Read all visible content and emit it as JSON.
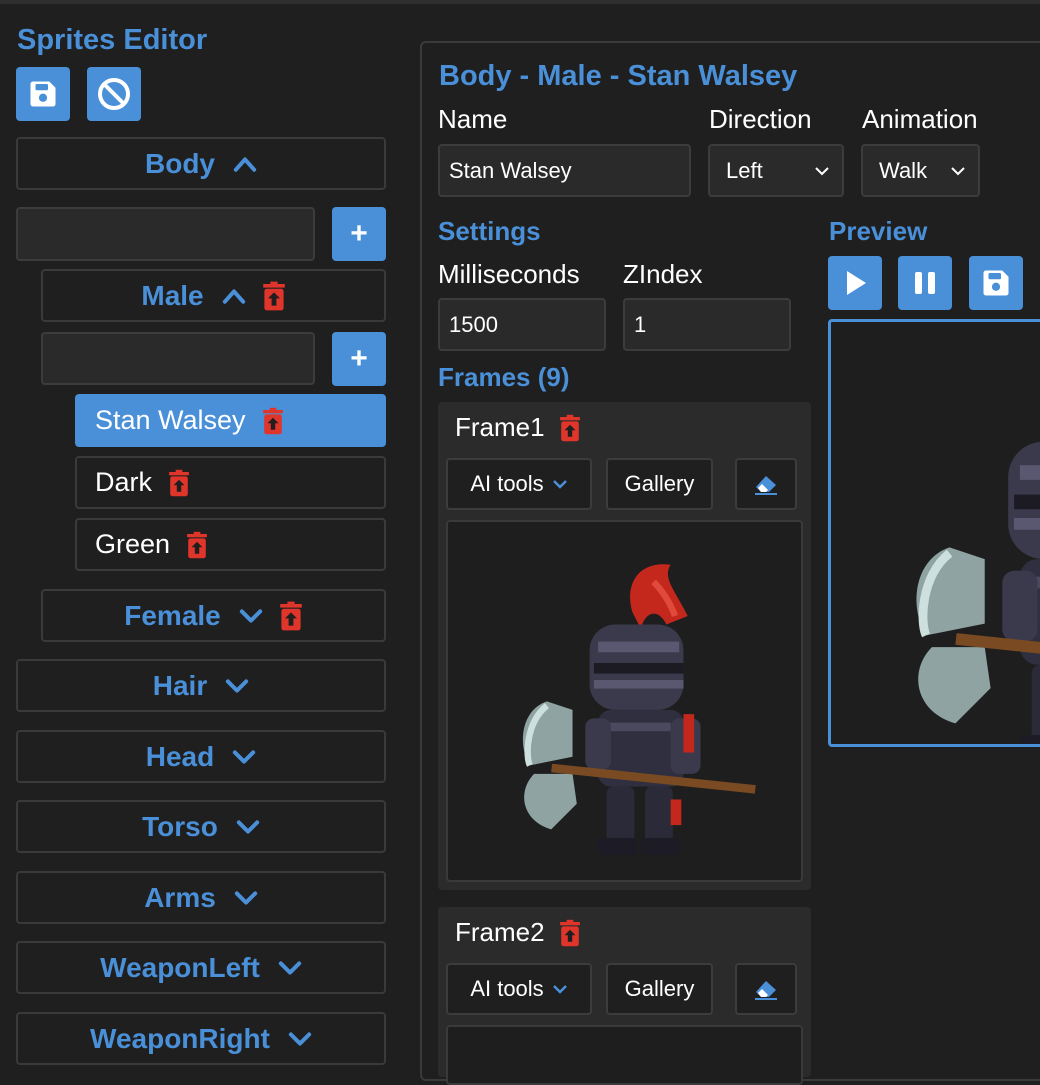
{
  "app": {
    "title": "Sprites Editor"
  },
  "toolbar": {
    "save_icon": "save-icon",
    "cancel_icon": "ban-icon"
  },
  "sidebar": {
    "body_label": "Body",
    "male_label": "Male",
    "female_label": "Female",
    "plus_label": "+",
    "male_items": [
      {
        "label": "Stan Walsey",
        "active": true
      },
      {
        "label": "Dark",
        "active": false
      },
      {
        "label": "Green",
        "active": false
      }
    ],
    "sections": [
      {
        "label": "Hair"
      },
      {
        "label": "Head"
      },
      {
        "label": "Torso"
      },
      {
        "label": "Arms"
      },
      {
        "label": "WeaponLeft"
      },
      {
        "label": "WeaponRight"
      }
    ]
  },
  "editor": {
    "title": "Body - Male - Stan Walsey",
    "name_label": "Name",
    "name_value": "Stan Walsey",
    "direction_label": "Direction",
    "direction_value": "Left",
    "animation_label": "Animation",
    "animation_value": "Walk",
    "settings_label": "Settings",
    "ms_label": "Milliseconds",
    "ms_value": "1500",
    "zindex_label": "ZIndex",
    "zindex_value": "1",
    "frames_label": "Frames (9)",
    "preview_label": "Preview"
  },
  "frames": [
    {
      "title": "Frame1",
      "ai_label": "AI tools",
      "gallery_label": "Gallery"
    },
    {
      "title": "Frame2",
      "ai_label": "AI tools",
      "gallery_label": "Gallery"
    }
  ],
  "colors": {
    "accent": "#4a90d9",
    "danger": "#e0352b",
    "background": "#1f1f1f"
  }
}
